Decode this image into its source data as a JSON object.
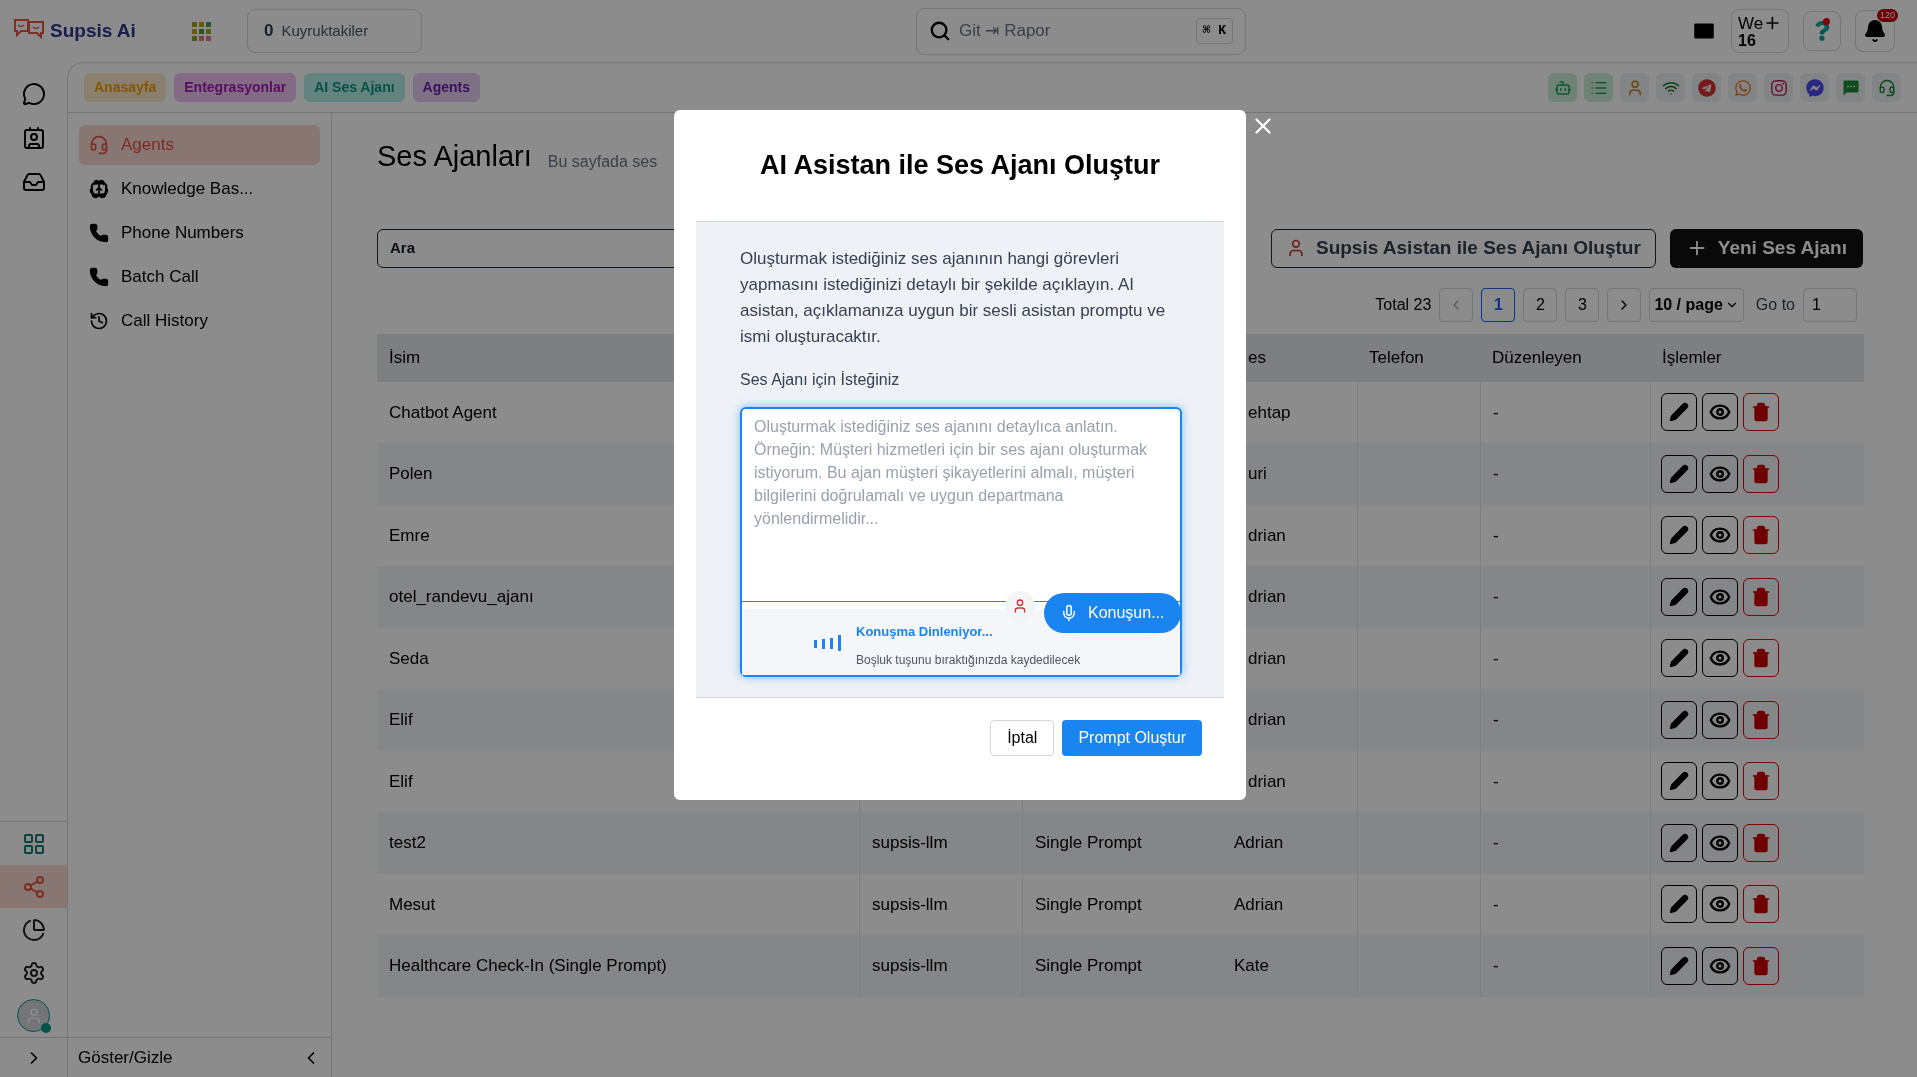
{
  "topbar": {
    "logo": "Supsis Ai",
    "queue": {
      "count": "0",
      "label": "Kuyruktakiler"
    },
    "search": {
      "placeholder": "Git ⇥ Rapor",
      "shortcut": "⌘ K"
    },
    "week": {
      "label": "We",
      "number": "16"
    },
    "notifications": "120"
  },
  "breadcrumbs": [
    {
      "label": "Anasayfa",
      "kind": "home"
    },
    {
      "label": "Entegrasyonlar",
      "kind": "integrations"
    },
    {
      "label": "AI Ses Ajanı",
      "kind": "voice"
    },
    {
      "label": "Agents",
      "kind": "agents"
    }
  ],
  "rail": [
    {
      "kind": "apps",
      "selected": false
    },
    {
      "kind": "share",
      "selected": true
    },
    {
      "kind": "reports",
      "selected": false
    },
    {
      "kind": "settings",
      "selected": false
    }
  ],
  "sidebar": {
    "items": [
      {
        "label": "Agents",
        "kind": "agents",
        "selected": true
      },
      {
        "label": "Knowledge Bas...",
        "kind": "knowledge",
        "selected": false
      },
      {
        "label": "Phone Numbers",
        "kind": "phone",
        "selected": false
      },
      {
        "label": "Batch Call",
        "kind": "phone",
        "selected": false
      },
      {
        "label": "Call History",
        "kind": "history",
        "selected": false
      }
    ],
    "footer": "Göster/Gizle"
  },
  "page": {
    "title": "Ses Ajanları",
    "subtitle": "Bu sayfada ses",
    "search": {
      "placeholder": "Ara"
    },
    "assistant_button": "Supsis Asistan ile Ses Ajanı Oluştur",
    "new_button": "Yeni Ses Ajanı",
    "pagination": {
      "total": "Total 23",
      "pages": [
        {
          "label": "1",
          "selected": true
        },
        {
          "label": "2",
          "selected": false
        },
        {
          "label": "3",
          "selected": false
        }
      ],
      "page_size": "10 / page",
      "goto_label": "Go to",
      "goto_value": "1"
    },
    "table": {
      "columns": {
        "name": "İsim",
        "column_4": "es",
        "phone": "Telefon",
        "editor": "Düzenleyen",
        "actions": "İşlemler"
      },
      "rows": [
        {
          "name": "Chatbot Agent",
          "voice": "ehtap",
          "editor": "-"
        },
        {
          "name": "Polen",
          "voice": "uri",
          "editor": "-"
        },
        {
          "name": "Emre",
          "voice": "drian",
          "editor": "-"
        },
        {
          "name": "otel_randevu_ajanı",
          "voice": "drian",
          "editor": "-"
        },
        {
          "name": "Seda",
          "voice": "drian",
          "editor": "-"
        },
        {
          "name": "Elif",
          "voice": "drian",
          "editor": "-"
        },
        {
          "name": "Elif",
          "voice": "drian",
          "editor": "-"
        },
        {
          "name": "test2",
          "model": "supsis-llm",
          "type": "Single Prompt",
          "voice": "Adrian",
          "editor": "-"
        },
        {
          "name": "Mesut",
          "model": "supsis-llm",
          "type": "Single Prompt",
          "voice": "Adrian",
          "editor": "-"
        },
        {
          "name": "Healthcare Check-In (Single Prompt)",
          "model": "supsis-llm",
          "type": "Single Prompt",
          "voice": "Kate",
          "editor": "-"
        }
      ]
    }
  },
  "modal": {
    "title": "AI Asistan ile Ses Ajanı Oluştur",
    "description": "Oluşturmak istediğiniz ses ajanının hangi görevleri yapmasını istediğinizi detaylı bir şekilde açıklayın. AI asistan, açıklamanıza uygun bir sesli asistan promptu ve ismi oluşturacaktır.",
    "field_label": "Ses Ajanı için İsteğiniz",
    "placeholder": "Oluşturmak istediğiniz ses ajanını detaylıca anlatın. Örneğin: Müşteri hizmetleri için bir ses ajanı oluşturmak istiyorum. Bu ajan müşteri şikayetlerini almalı, müşteri bilgilerini doğrulamalı ve uygun departmana yönlendirmelidir...",
    "listening": true,
    "listening_status": "Konuşma Dinleniyor...",
    "listening_hint": "Boşluk tuşunu bıraktığınızda kaydedilecek",
    "mic_button": "Konuşun...",
    "cancel": "İptal",
    "submit": "Prompt Oluştur"
  }
}
